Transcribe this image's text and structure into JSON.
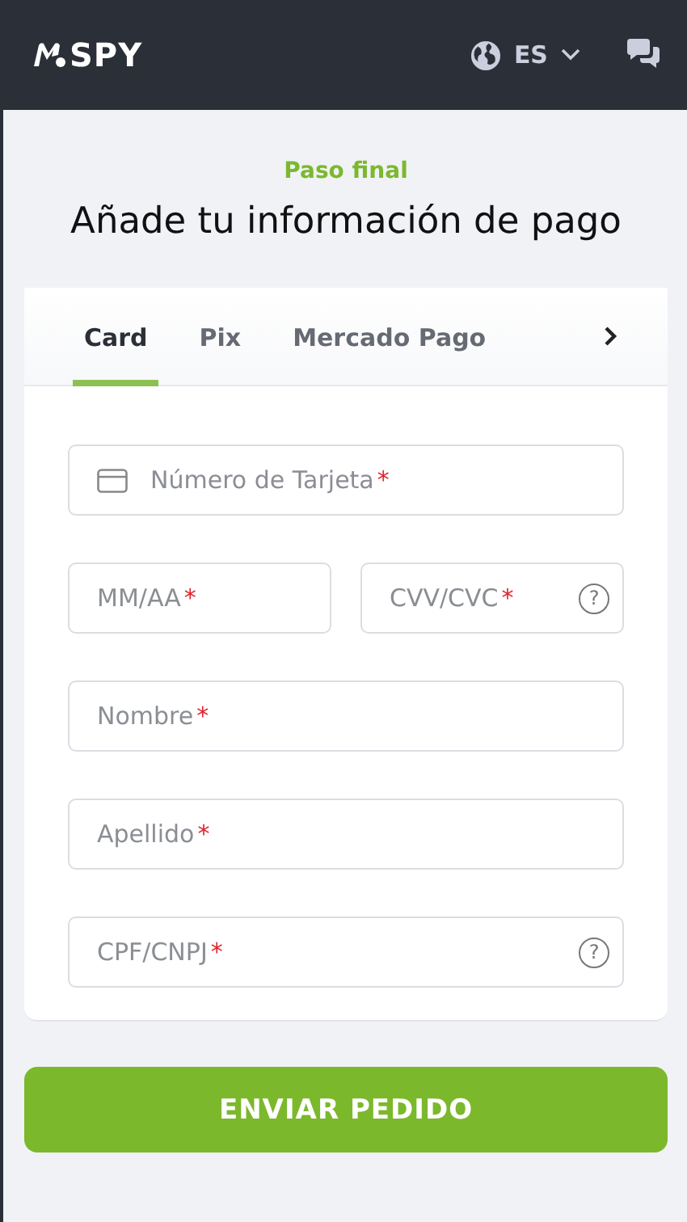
{
  "header": {
    "logo": "SPY",
    "language": "ES"
  },
  "step": "Paso final",
  "title": "Añade tu información de pago",
  "tabs": [
    {
      "label": "Card",
      "selected": true
    },
    {
      "label": "Pix",
      "selected": false
    },
    {
      "label": "Mercado Pago",
      "selected": false
    }
  ],
  "form_rows": [
    [
      {
        "kind": "card",
        "placeholder": "Número de Tarjeta",
        "required_mark": "*"
      }
    ],
    [
      {
        "kind": "text",
        "placeholder": "MM/AA",
        "required_mark": "*"
      },
      {
        "kind": "help",
        "placeholder": "CVV/CVC",
        "required_mark": "*",
        "help": "?"
      }
    ],
    [
      {
        "kind": "text",
        "placeholder": "Nombre",
        "required_mark": "*"
      }
    ],
    [
      {
        "kind": "text",
        "placeholder": "Apellido",
        "required_mark": "*"
      }
    ],
    [
      {
        "kind": "help",
        "placeholder": "CPF/CNPJ",
        "required_mark": "*",
        "help": "?"
      }
    ]
  ],
  "submit": "ENVIAR PEDIDO"
}
